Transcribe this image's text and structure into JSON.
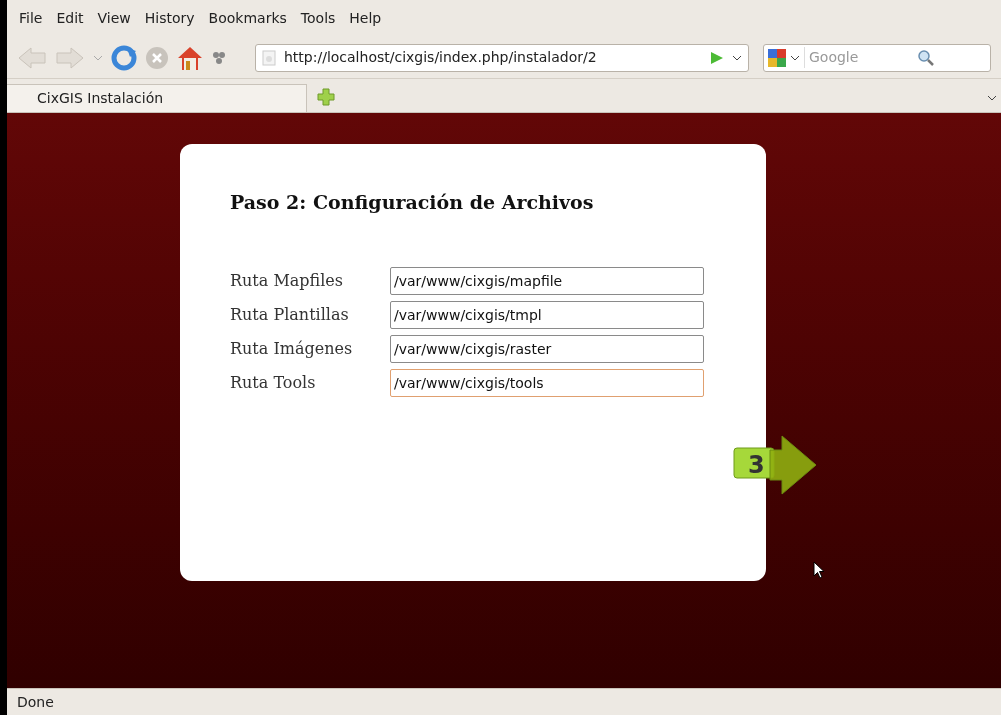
{
  "menu": [
    "File",
    "Edit",
    "View",
    "History",
    "Bookmarks",
    "Tools",
    "Help"
  ],
  "address_bar": {
    "value": "http://localhost/cixgis/index.php/instalador/2"
  },
  "search": {
    "placeholder": "Google"
  },
  "tabs": [
    {
      "label": "CixGIS Instalación",
      "selected": true
    }
  ],
  "page": {
    "title": "Paso 2: Configuración de Archivos",
    "fields": [
      {
        "label": "Ruta Mapfiles",
        "value": "/var/www/cixgis/mapfile",
        "focused": false
      },
      {
        "label": "Ruta Plantillas",
        "value": "/var/www/cixgis/tmpl",
        "focused": false
      },
      {
        "label": "Ruta Imágenes",
        "value": "/var/www/cixgis/raster",
        "focused": false
      },
      {
        "label": "Ruta Tools",
        "value": "/var/www/cixgis/tools",
        "focused": true
      }
    ],
    "next_step": "3"
  },
  "status_bar": "Done"
}
